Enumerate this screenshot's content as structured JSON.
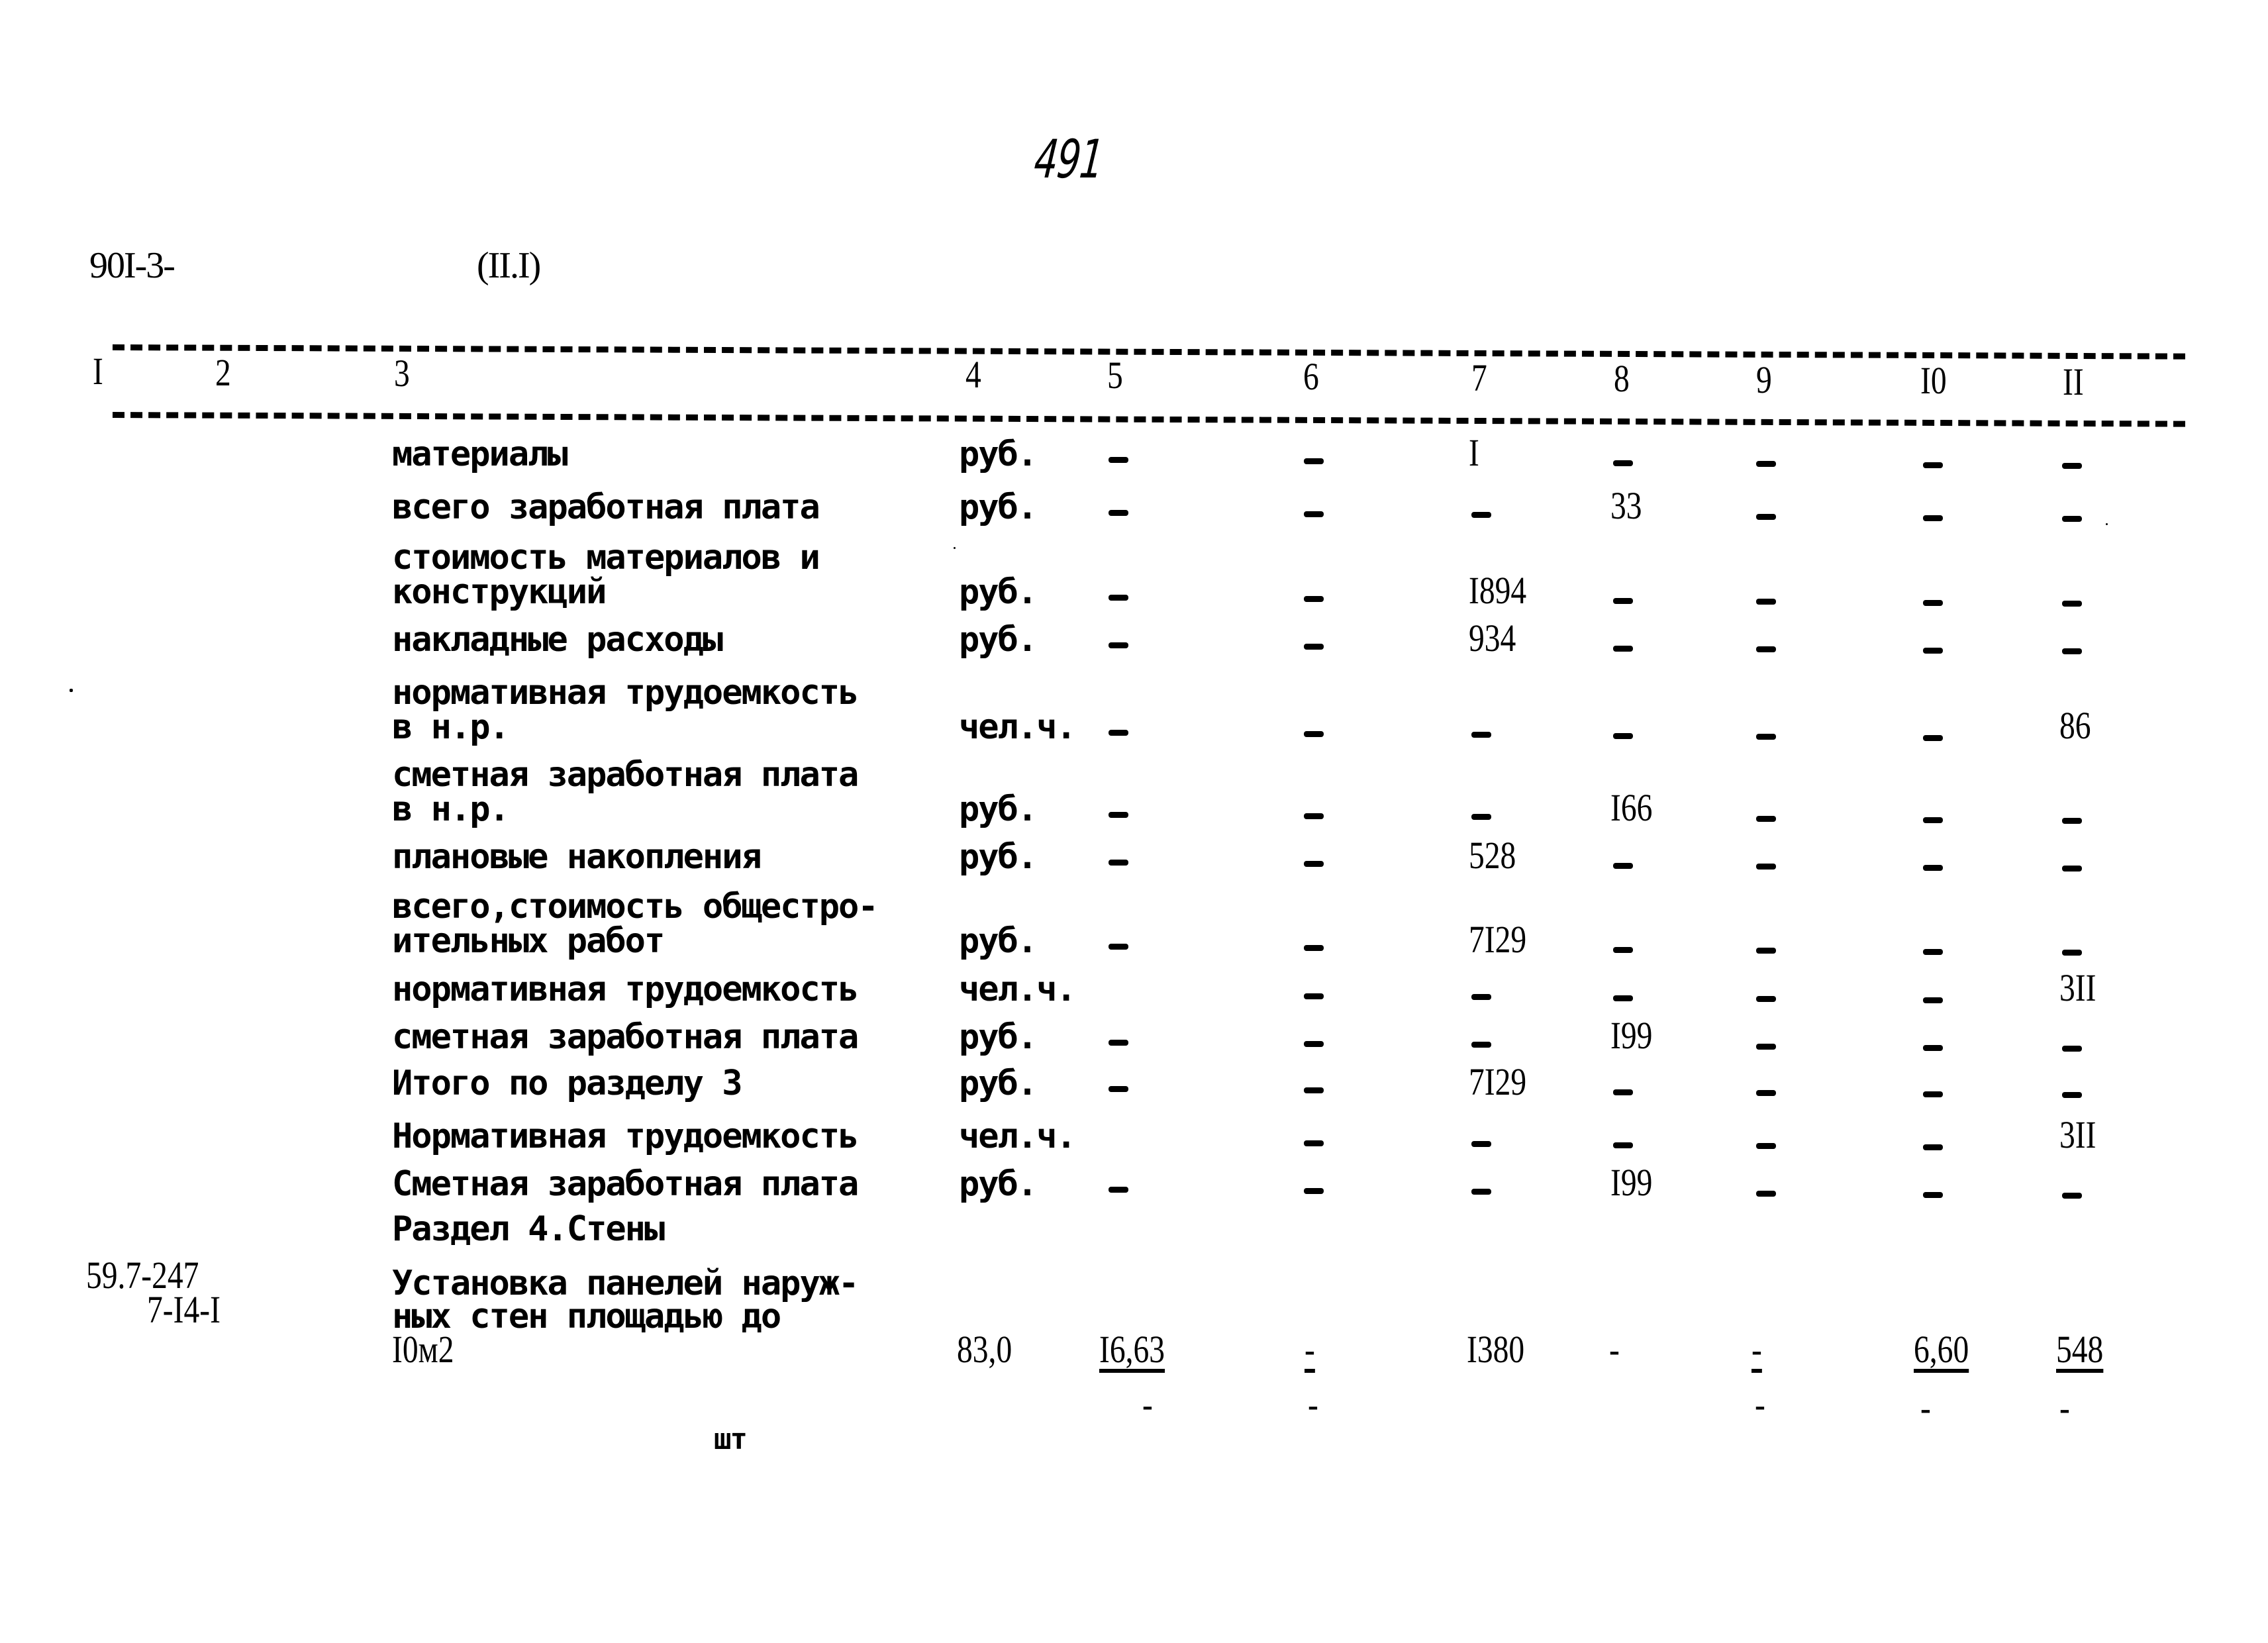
{
  "page_number": "491",
  "doc_code": "90I-3-",
  "table_ref": "(II.I)",
  "columns": [
    "I",
    "2",
    "3",
    "4",
    "5",
    "6",
    "7",
    "8",
    "9",
    "I0",
    "II"
  ],
  "rows": [
    {
      "desc": [
        "материалы"
      ],
      "unit": "руб.",
      "c5": "-",
      "c6": "-",
      "c7": "I",
      "c8": "-",
      "c9": "-",
      "c10": "-",
      "c11": "-"
    },
    {
      "desc": [
        "всего заработная плата"
      ],
      "unit": "руб.",
      "c5": "-",
      "c6": "-",
      "c7": "-",
      "c8": "33",
      "c9": "-",
      "c10": "-",
      "c11": "-"
    },
    {
      "desc": [
        "стоимость материалов и",
        "конструкций"
      ],
      "unit": "руб.",
      "c5": "-",
      "c6": "-",
      "c7": "I894",
      "c8": "-",
      "c9": "-",
      "c10": "-",
      "c11": "-"
    },
    {
      "desc": [
        "накладные расходы"
      ],
      "unit": "руб.",
      "c5": "-",
      "c6": "-",
      "c7": "934",
      "c8": "-",
      "c9": "-",
      "c10": "-",
      "c11": "-"
    },
    {
      "desc": [
        "нормативная трудоемкость",
        "в н.р."
      ],
      "unit": "чел.ч.",
      "c5": "-",
      "c6": "-",
      "c7": "-",
      "c8": "-",
      "c9": "-",
      "c10": "-",
      "c11": "86"
    },
    {
      "desc": [
        "сметная заработная плата",
        "в н.р."
      ],
      "unit": "руб.",
      "c5": "-",
      "c6": "-",
      "c7": "-",
      "c8": "I66",
      "c9": "-",
      "c10": "-",
      "c11": "-"
    },
    {
      "desc": [
        "плановые накопления"
      ],
      "unit": "руб.",
      "c5": "-",
      "c6": "-",
      "c7": "528",
      "c8": "-",
      "c9": "-",
      "c10": "-",
      "c11": "-"
    },
    {
      "desc": [
        "всего,стоимость общестро-",
        "ительных работ"
      ],
      "unit": "руб.",
      "c5": "-",
      "c6": "-",
      "c7": "7I29",
      "c8": "-",
      "c9": "-",
      "c10": "-",
      "c11": "-"
    },
    {
      "desc": [
        "нормативная трудоемкость"
      ],
      "unit": "чел.ч.",
      "c5": "",
      "c6": "-",
      "c7": "-",
      "c8": "-",
      "c9": "-",
      "c10": "-",
      "c11": "3II"
    },
    {
      "desc": [
        "сметная заработная плата"
      ],
      "unit": "руб.",
      "c5": "-",
      "c6": "-",
      "c7": "-",
      "c8": "I99",
      "c9": "-",
      "c10": "-",
      "c11": "-"
    },
    {
      "desc": [
        "Итого по разделу 3"
      ],
      "unit": "руб.",
      "c5": "-",
      "c6": "-",
      "c7": "7I29",
      "c8": "-",
      "c9": "-",
      "c10": "-",
      "c11": "-"
    },
    {
      "desc": [
        "Нормативная трудоемкость"
      ],
      "unit": "чел.ч.",
      "c5": "",
      "c6": "-",
      "c7": "-",
      "c8": "-",
      "c9": "-",
      "c10": "-",
      "c11": "3II"
    },
    {
      "desc": [
        "Сметная заработная плата"
      ],
      "unit": "руб.",
      "c5": "-",
      "c6": "-",
      "c7": "-",
      "c8": "I99",
      "c9": "-",
      "c10": "-",
      "c11": "-"
    }
  ],
  "section_heading": "Раздел 4.Стены",
  "item": {
    "code_line1": "59.7-247",
    "code_line2": "7-I4-I",
    "desc": [
      "Установка панелей наруж-",
      "ных стен площадью до",
      "I0м2"
    ],
    "unit_below": "шт",
    "c4": "83,0",
    "c5_top": "I6,63",
    "c5_bottom": "-",
    "c6_top": "-",
    "c6_bottom": "-",
    "c7": "I380",
    "c8": "-",
    "c9_top": "-",
    "c9_bottom": "-",
    "c10_top": "6,60",
    "c10_bottom": "-",
    "c11_top": "548",
    "c11_bottom": "-"
  }
}
